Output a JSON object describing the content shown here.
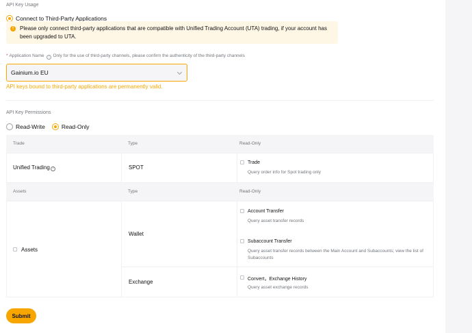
{
  "usage": {
    "section_label": "API Key Usage",
    "option_label": "Connect to Third-Party Applications",
    "warning": "Please only connect third-party applications that are compatible with Unified Trading Account (UTA) trading, if your account has been upgraded to UTA."
  },
  "app_name": {
    "label": "Application Name",
    "hint": "Only for the use of third-party channels, please confirm the authenticity of the third-party channels",
    "selected": "Gainium.io EU",
    "validity_note": "API keys bound to third-party applications are permanently valid."
  },
  "permissions": {
    "section_label": "API Key Permissions",
    "options": [
      {
        "label": "Read-Write",
        "checked": false
      },
      {
        "label": "Read-Only",
        "checked": true
      }
    ]
  },
  "trade_table": {
    "headers": [
      "Trade",
      "Type",
      "Read-Only"
    ],
    "row": {
      "category": "Unified Trading",
      "type": "SPOT",
      "perm_title": "Trade",
      "perm_desc": "Query order info for Spot trading only"
    }
  },
  "assets_table": {
    "headers": [
      "Assets",
      "Type",
      "Read-Only"
    ],
    "category": "Assets",
    "wallet": {
      "type": "Wallet",
      "perms": [
        {
          "title": "Account Transfer",
          "desc": "Query asset transfer records"
        },
        {
          "title": "Subaccount Transfer",
          "desc": "Query asset transfer records between the Main Account and Subaccounts; view the list of Subaccounts"
        }
      ]
    },
    "exchange": {
      "type": "Exchange",
      "perm_title": "Convert，Exchange History",
      "perm_desc": "Query asset exchange records"
    }
  },
  "submit_label": "Submit",
  "colors": {
    "accent": "#f7a600",
    "warning_bg": "#fff7e6",
    "required": "#e94359"
  }
}
